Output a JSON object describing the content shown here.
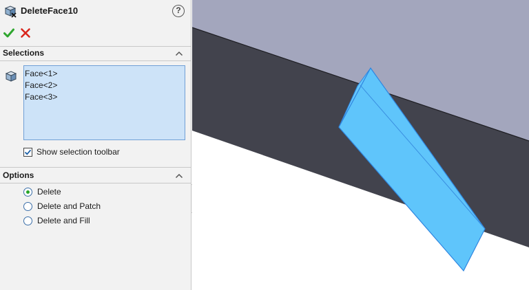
{
  "panel": {
    "title": "DeleteFace10",
    "help_label": "?",
    "icons": {
      "feature": "delete-face-icon",
      "help": "help-icon",
      "ok": "checkmark-icon",
      "cancel": "close-icon"
    }
  },
  "selections": {
    "title": "Selections",
    "items": [
      "Face<1>",
      "Face<2>",
      "Face<3>"
    ],
    "show_toolbar_label": "Show selection toolbar",
    "show_toolbar_checked": true
  },
  "options": {
    "title": "Options",
    "choices": [
      {
        "label": "Delete",
        "selected": true
      },
      {
        "label": "Delete and Patch",
        "selected": false
      },
      {
        "label": "Delete and Fill",
        "selected": false
      }
    ]
  },
  "colors": {
    "panel_bg": "#f2f2f2",
    "list_bg": "#cde3f8",
    "top_face": "#a3a6bd",
    "side_face": "#42434d",
    "highlight": "#5fc5fb",
    "ok_green": "#2fa62f",
    "cancel_red": "#d9261c"
  }
}
